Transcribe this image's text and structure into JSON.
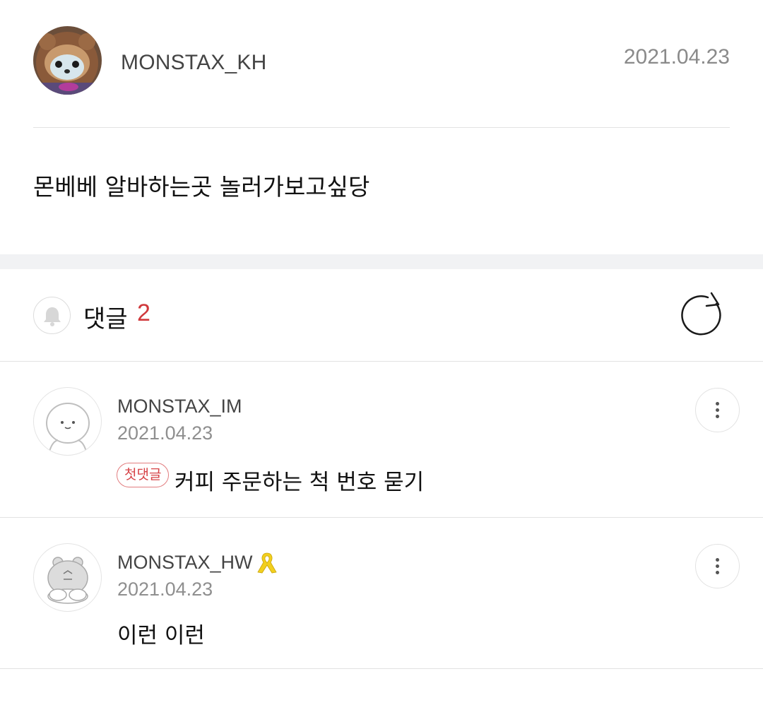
{
  "post": {
    "author": "MONSTAX_KH",
    "date": "2021.04.23",
    "body": "몬베베 알바하는곳 놀러가보고싶당"
  },
  "comments_header": {
    "label": "댓글",
    "count": "2",
    "bell_icon": "bell-icon",
    "refresh_icon": "refresh-icon"
  },
  "comments": [
    {
      "author": "MONSTAX_IM",
      "date": "2021.04.23",
      "badge": "첫댓글",
      "text": "커피 주문하는 척 번호 묻기"
    },
    {
      "author": "MONSTAX_HW",
      "date": "2021.04.23",
      "text": "이런 이런",
      "ribbon_icon": "yellow-ribbon-icon"
    }
  ],
  "colors": {
    "accent_red": "#d0393c",
    "divider": "#e2e2e2",
    "band": "#f1f2f4",
    "ribbon_yellow": "#f2cf1e"
  }
}
